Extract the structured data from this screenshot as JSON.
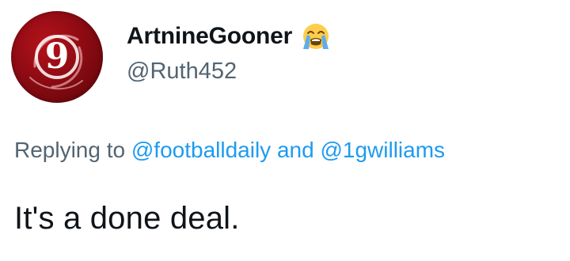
{
  "author": {
    "avatar_glyph": "9",
    "display_name": "ArtnineGooner",
    "name_emoji": "loudly-crying-face-icon",
    "handle": "@Ruth452"
  },
  "reply_context": {
    "prefix": "Replying to",
    "mention_1": "@footballdaily",
    "connector": "and",
    "mention_2": "@1gwilliams"
  },
  "tweet": {
    "text": "It's a done deal."
  },
  "colors": {
    "mention_blue": "#1d9bf0",
    "secondary_gray": "#536471",
    "primary_text": "#0f1419",
    "avatar_red": "#b5121b"
  }
}
